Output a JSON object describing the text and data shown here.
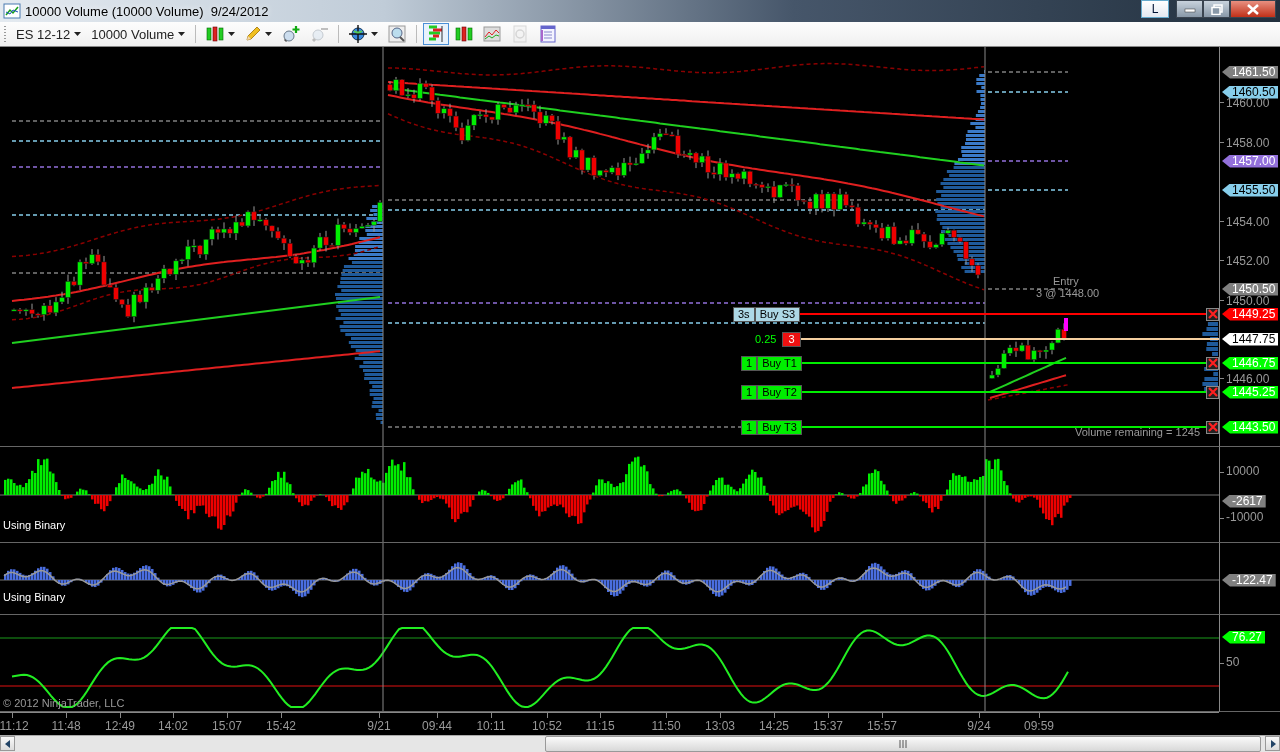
{
  "window": {
    "title": "10000 Volume (10000 Volume)  9/24/2012",
    "language_button": "L"
  },
  "toolbar": {
    "instrument": "ES 12-12",
    "period": "10000 Volume",
    "chart_tools": [
      {
        "kind": "order-panel",
        "selected": true,
        "disabled": false
      },
      {
        "kind": "bars",
        "selected": false,
        "disabled": false
      },
      {
        "kind": "indicators",
        "selected": false,
        "disabled": false
      },
      {
        "kind": "money",
        "selected": false,
        "disabled": true
      },
      {
        "kind": "data-box",
        "selected": false,
        "disabled": false
      }
    ]
  },
  "price_panel": {
    "axis_labels": [
      "1460.00",
      "1458.00",
      "1454.00",
      "1452.00",
      "1450.00",
      "1446.00"
    ],
    "price_tags": [
      {
        "text": "1461.50",
        "color": "#808080"
      },
      {
        "text": "1460.50",
        "color": "#87ceeb"
      },
      {
        "text": "1457.00",
        "color": "#9370db"
      },
      {
        "text": "1455.50",
        "color": "#87ceeb"
      },
      {
        "text": "1450.50",
        "color": "#808080"
      },
      {
        "text": "1449.25",
        "color": "#ff0000"
      },
      {
        "text": "1447.75",
        "color": "#ffffff"
      },
      {
        "text": "1446.75",
        "color": "#00ff00"
      },
      {
        "text": "1445.25",
        "color": "#00ff00"
      },
      {
        "text": "1443.50",
        "color": "#00ff00"
      }
    ],
    "entry_marker": {
      "label": "Entry",
      "detail": "3 @ 1448.00"
    },
    "orders": [
      {
        "kind": "stop",
        "quantity": "3s",
        "label": "Buy S3"
      },
      {
        "kind": "position",
        "pnl": "0.25",
        "quantity": "3"
      },
      {
        "kind": "target",
        "quantity": "1",
        "label": "Buy T1"
      },
      {
        "kind": "target",
        "quantity": "1",
        "label": "Buy T2"
      },
      {
        "kind": "target",
        "quantity": "1",
        "label": "Buy T3"
      }
    ],
    "volume_remaining": "Volume remaining = 1245"
  },
  "indicator_panels": [
    {
      "kind": "binary-histogram",
      "label": "Using Binary",
      "axis_labels": [
        "10000",
        "-10000"
      ],
      "tag": {
        "text": "-2617",
        "color": "#808080"
      }
    },
    {
      "kind": "blue-histogram",
      "label": "Using Binary",
      "tag": {
        "text": "-122.47",
        "color": "#808080"
      }
    },
    {
      "kind": "oscillator",
      "axis_labels": [
        "50"
      ],
      "tag": {
        "text": "76.27",
        "color": "#00ff00"
      }
    }
  ],
  "copyright": "© 2012 NinjaTrader, LLC",
  "time_axis": [
    "11:12",
    "11:48",
    "12:49",
    "14:02",
    "15:07",
    "15:42",
    "9/21",
    "09:44",
    "10:11",
    "10:52",
    "11:15",
    "11:50",
    "13:03",
    "14:25",
    "15:37",
    "15:57",
    "9/24",
    "09:59"
  ]
}
